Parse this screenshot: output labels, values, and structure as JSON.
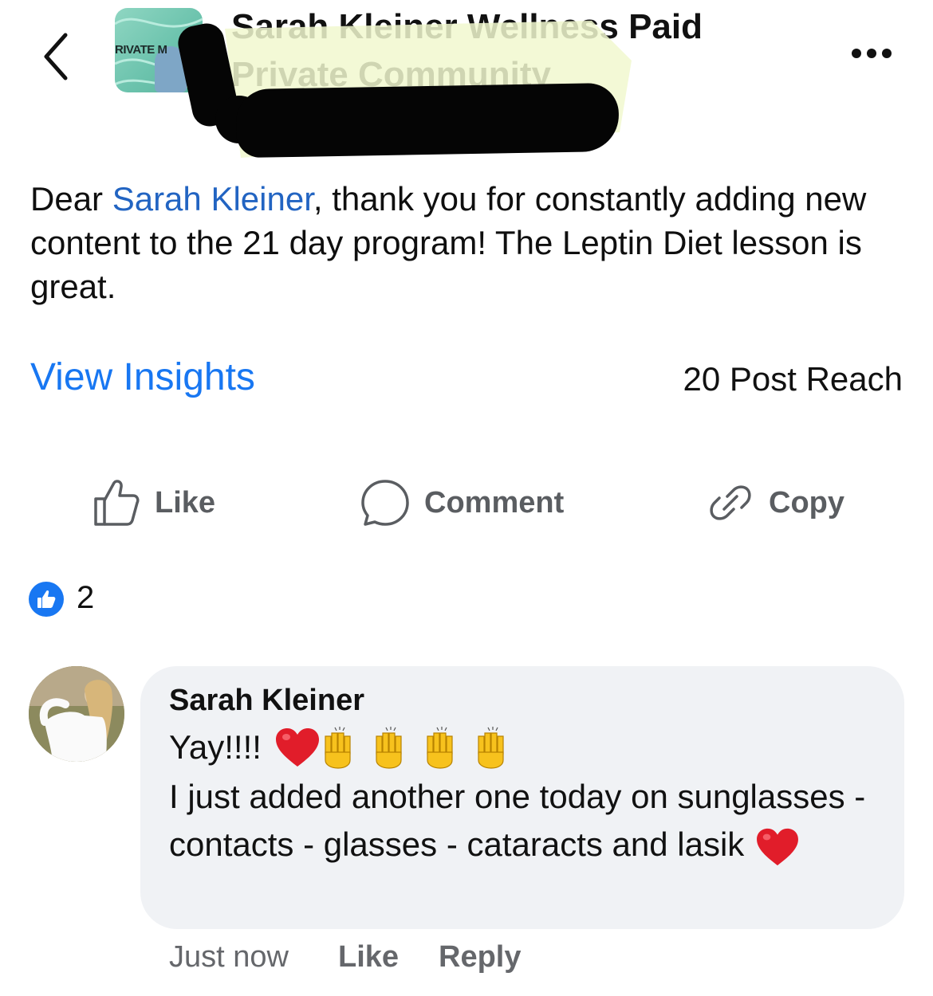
{
  "header": {
    "back_icon": "chevron-left-icon",
    "group_title": "Sarah Kleiner Wellness Paid Private Community",
    "group_avatar_label": "RIVATE M",
    "more_icon": "more-horizontal-icon"
  },
  "post": {
    "text_before": "Dear ",
    "mention": "Sarah Kleiner",
    "text_after": ", thank you for constantly adding new content to the 21 day program! The Leptin Diet lesson is great."
  },
  "insights": {
    "link_label": "View Insights",
    "reach_label": "20 Post Reach"
  },
  "actions": {
    "like_label": "Like",
    "comment_label": "Comment",
    "copy_label": "Copy"
  },
  "reactions": {
    "count": "2",
    "icon": "thumbs-up-icon",
    "color": "#1877f2"
  },
  "comment": {
    "author": "Sarah Kleiner",
    "line1": "Yay!!!!",
    "body": "I just added another one today on sunglasses - contacts - glasses - cataracts and lasik",
    "emojis": [
      "heart",
      "raised-hands",
      "raised-hands",
      "raised-hands",
      "raised-hands"
    ],
    "time": "Just now",
    "like_label": "Like",
    "reply_label": "Reply"
  },
  "colors": {
    "link": "#1877f2",
    "mention": "#2264c2",
    "bubble": "#f0f2f5",
    "secondary_text": "#65676b"
  }
}
